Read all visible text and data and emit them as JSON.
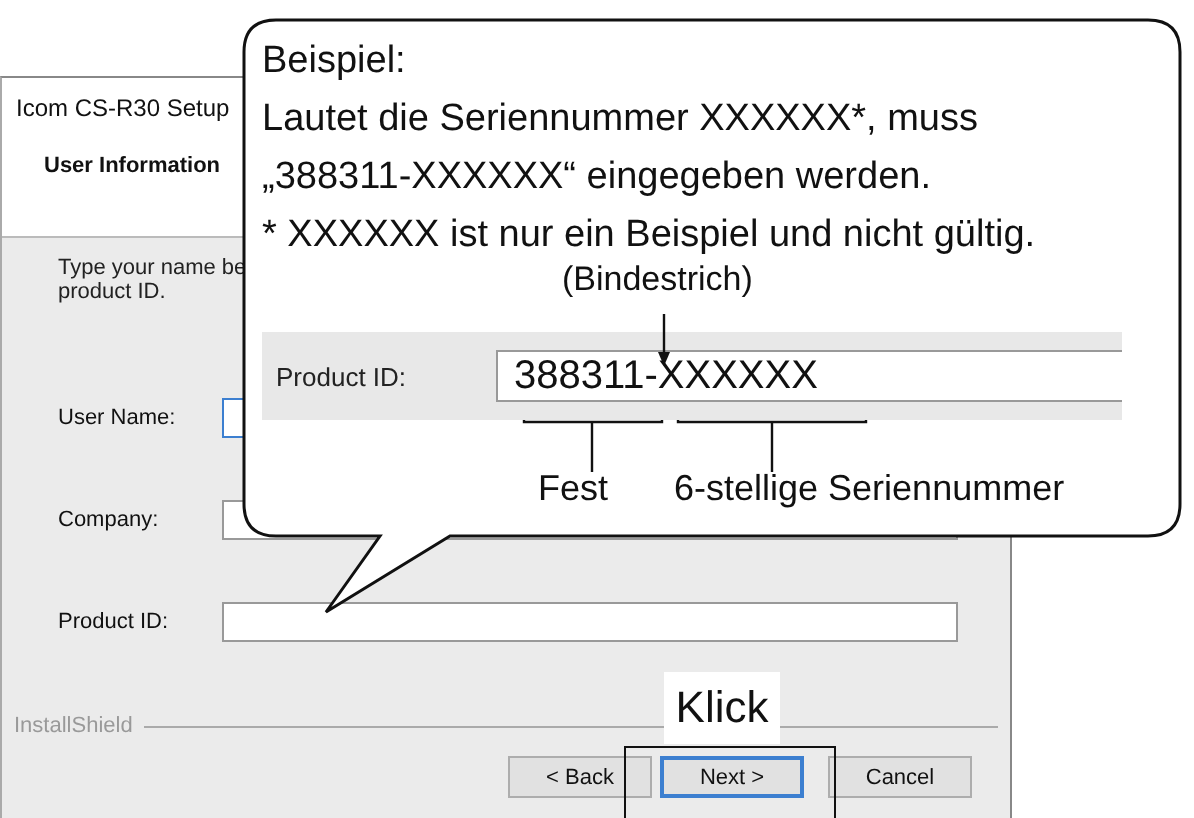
{
  "window": {
    "title": "Icom CS-R30 Setup",
    "heading": "User Information"
  },
  "instruction": "Type your name be\nproduct ID.",
  "fields": [
    {
      "label": "User Name:",
      "focused": true
    },
    {
      "label": "Company:",
      "focused": false
    },
    {
      "label": "Product ID:",
      "focused": false
    }
  ],
  "brand": "InstallShield",
  "buttons": [
    {
      "label": "< Back",
      "focused": false
    },
    {
      "label": "Next >",
      "focused": true
    },
    {
      "label": "Cancel",
      "focused": false
    }
  ],
  "callout": {
    "lines": [
      "Beispiel:",
      "Lautet die Seriennummer XXXXXX*, muss",
      "„388311-XXXXXX“ eingegeben werden.",
      "* XXXXXX ist nur ein Beispiel und nicht gültig."
    ],
    "hyphen_label": "(Bindestrich)",
    "field_label": "Product ID:",
    "field_value": "388311-XXXXXX",
    "fixed_label": "Fest",
    "serial_label": "6-stellige Seriennummer"
  },
  "click_label": "Klick"
}
